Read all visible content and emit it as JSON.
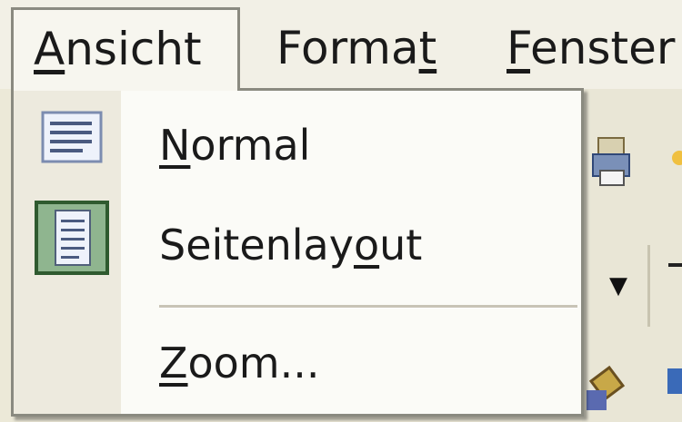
{
  "menubar": {
    "items": [
      {
        "label": "Ansicht",
        "mnemonic_index": 0,
        "active": true
      },
      {
        "label": "Format",
        "mnemonic_index": 5
      },
      {
        "label": "Fenster",
        "mnemonic_index": 0
      }
    ]
  },
  "menu": {
    "items": [
      {
        "label": "Normal",
        "mnemonic_index": 0,
        "icon": "normal-view-icon"
      },
      {
        "label": "Seitenlayout",
        "mnemonic_index": 9,
        "icon": "page-layout-icon",
        "checked": true
      },
      {
        "label": "Zoom...",
        "mnemonic_index": 0,
        "icon": null
      }
    ]
  },
  "colors": {
    "menu_bg": "#fbfbf7",
    "gutter_bg": "#edeade",
    "border": "#8a8a80",
    "checked_icon_frame": "#3c6e3c"
  }
}
